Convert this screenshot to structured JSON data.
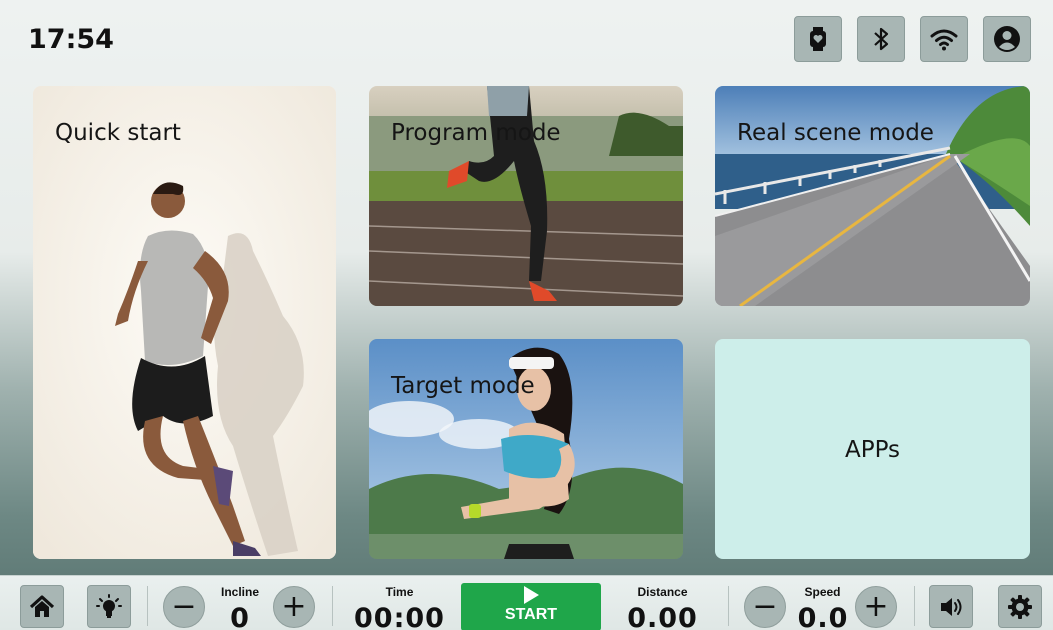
{
  "status": {
    "time": "17:54",
    "icons": [
      "watch-heart-icon",
      "bluetooth-icon",
      "wifi-icon",
      "user-icon"
    ]
  },
  "tiles": {
    "quick_start": "Quick start",
    "program_mode": "Program mode",
    "real_scene_mode": "Real scene mode",
    "target_mode": "Target mode",
    "apps": "APPs"
  },
  "controls": {
    "incline": {
      "label": "Incline",
      "value": "0"
    },
    "time": {
      "label": "Time",
      "value": "00:00"
    },
    "start_label": "START",
    "distance": {
      "label": "Distance",
      "value": "0.00"
    },
    "speed": {
      "label": "Speed",
      "value": "0.0"
    },
    "minus": "−",
    "plus": "+"
  },
  "colors": {
    "button_bg": "#a8b6b4",
    "start_green": "#1fa64a",
    "apps_tile": "#cdeeea"
  }
}
